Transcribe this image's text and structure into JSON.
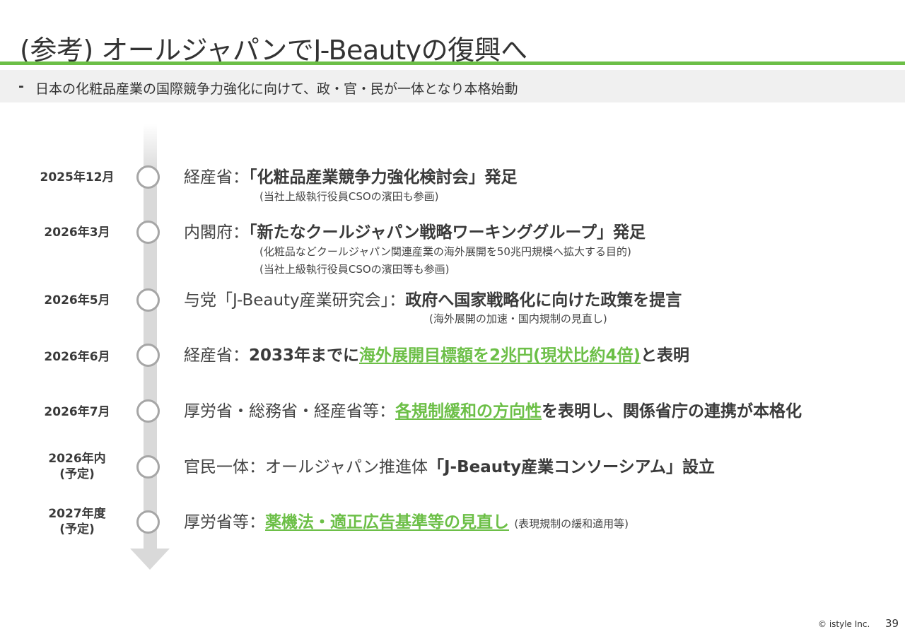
{
  "header": {
    "title": "(参考) オールジャパンでJ-Beautyの復興へ",
    "subtitle_dash": "-",
    "subtitle": "日本の化粧品産業の国際競争力強化に向けて、政・官・民が一体となり本格始動"
  },
  "colors": {
    "accent_green": "#6cbf47",
    "timeline_gray": "#d9d9d9",
    "circle_border": "#a6a6a6"
  },
  "timeline": [
    {
      "date_line1": "2025年12月",
      "date_line2": "",
      "org": "経産省：",
      "part_a": "「化粧品産業競争力強化検討会」発足",
      "part_b": "",
      "part_c": "",
      "notes": [
        "(当社上級執行役員CSOの濱田も参画)"
      ]
    },
    {
      "date_line1": "2026年3月",
      "date_line2": "",
      "org": "内閣府：",
      "part_a": "「新たなクールジャパン戦略ワーキンググループ」発足",
      "part_b": "",
      "part_c": "",
      "notes": [
        "(化粧品などクールジャパン関連産業の海外展開を50兆円規模へ拡大する目的)",
        "(当社上級執行役員CSOの濱田等も参画)"
      ]
    },
    {
      "date_line1": "2026年5月",
      "date_line2": "",
      "org": "与党「J-Beauty産業研究会」：",
      "part_a": "政府へ国家戦略化に向けた政策を提言",
      "part_b": "",
      "part_c": "",
      "notes": [
        "(海外展開の加速・国内規制の見直し)"
      ]
    },
    {
      "date_line1": "2026年6月",
      "date_line2": "",
      "org": "経産省：",
      "part_a": "2033年までに",
      "part_b": "海外展開目標額を2兆円(現状比約4倍)",
      "part_c": "と表明",
      "notes": []
    },
    {
      "date_line1": "2026年7月",
      "date_line2": "",
      "org": "厚労省・総務省・経産省等：",
      "part_a": "",
      "part_b": "各規制緩和の方向性",
      "part_c": "を表明し、関係省庁の連携が本格化",
      "notes": []
    },
    {
      "date_line1": "2026年内",
      "date_line2": "(予定)",
      "org": "官民一体：オールジャパン推進体",
      "part_a": "「J-Beauty産業コンソーシアム」設立",
      "part_b": "",
      "part_c": "",
      "notes": []
    },
    {
      "date_line1": "2027年度",
      "date_line2": "(予定)",
      "org": "厚労省等：",
      "part_a": "",
      "part_b": "薬機法・適正広告基準等の見直し",
      "part_c": "",
      "inline_note": "(表現規制の緩和適用等)",
      "notes": []
    }
  ],
  "footer": {
    "copyright": "© istyle Inc.",
    "page_number": "39"
  }
}
